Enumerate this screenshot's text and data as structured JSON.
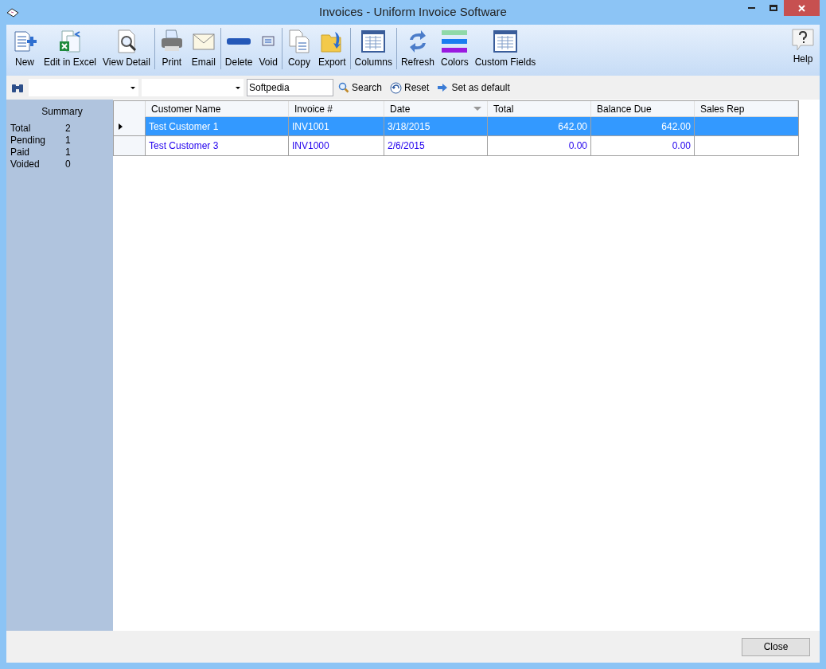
{
  "window": {
    "title": "Invoices - Uniform Invoice Software"
  },
  "toolbar": {
    "groups": [
      [
        {
          "label": "New",
          "kind": "new"
        },
        {
          "label": "Edit in Excel",
          "kind": "excel"
        },
        {
          "label": "View Detail",
          "kind": "detail"
        }
      ],
      [
        {
          "label": "Print",
          "kind": "print"
        },
        {
          "label": "Email",
          "kind": "email"
        }
      ],
      [
        {
          "label": "Delete",
          "kind": "delete"
        },
        {
          "label": "Void",
          "kind": "void"
        }
      ],
      [
        {
          "label": "Copy",
          "kind": "copy"
        },
        {
          "label": "Export",
          "kind": "export"
        }
      ],
      [
        {
          "label": "Columns",
          "kind": "columns"
        }
      ],
      [
        {
          "label": "Refresh",
          "kind": "refresh"
        },
        {
          "label": "Colors",
          "kind": "colors"
        },
        {
          "label": "Custom Fields",
          "kind": "columns"
        }
      ]
    ],
    "help": "Help"
  },
  "filter": {
    "search_text": "Softpedia",
    "search": "Search",
    "reset": "Reset",
    "set_default": "Set as default"
  },
  "summary": {
    "title": "Summary",
    "rows": [
      {
        "label": "Total",
        "value": "2"
      },
      {
        "label": "Pending",
        "value": "1"
      },
      {
        "label": "Paid",
        "value": "1"
      },
      {
        "label": "Voided",
        "value": "0"
      }
    ]
  },
  "table": {
    "columns": [
      {
        "label": "Customer Name",
        "kind": "text",
        "sorted": false
      },
      {
        "label": "Invoice #",
        "kind": "text",
        "sorted": false
      },
      {
        "label": "Date",
        "kind": "text",
        "sorted": true
      },
      {
        "label": "Total",
        "kind": "amount",
        "sorted": false
      },
      {
        "label": "Balance Due",
        "kind": "amount",
        "sorted": false
      },
      {
        "label": "Sales Rep",
        "kind": "text",
        "sorted": false
      }
    ],
    "rows": [
      {
        "selected": true,
        "cells": [
          "Test Customer 1",
          "INV1001",
          "3/18/2015",
          "642.00",
          "642.00",
          ""
        ]
      },
      {
        "selected": false,
        "cells": [
          "Test Customer 3",
          "INV1000",
          "2/6/2015",
          "0.00",
          "0.00",
          ""
        ]
      }
    ]
  },
  "footer": {
    "close": "Close"
  }
}
